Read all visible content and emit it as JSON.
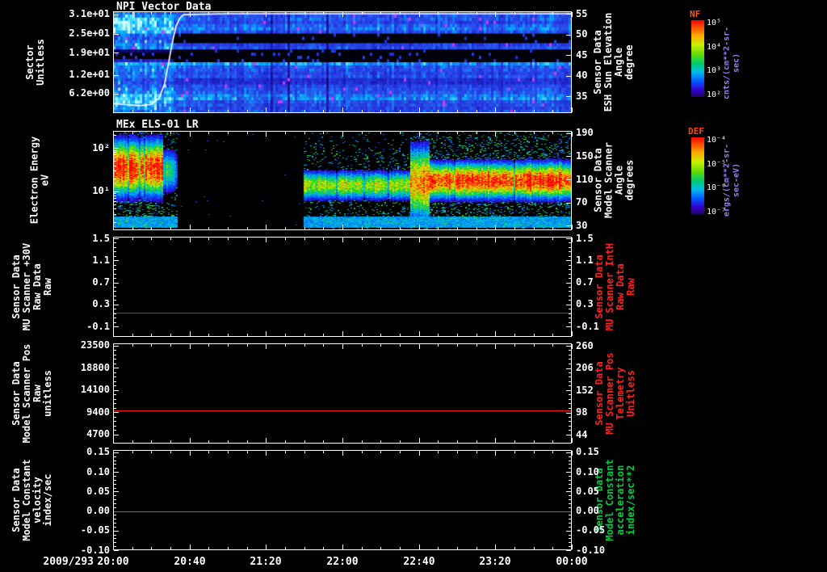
{
  "page": {
    "background": "#000000"
  },
  "panels": [
    {
      "title": "NPI Vector Data",
      "left_axis": {
        "label_lines": [
          "Sector",
          "Unitless"
        ],
        "ticks": [
          "3.1e+01",
          "2.5e+01",
          "1.9e+01",
          "1.2e+01",
          "6.2e+00"
        ],
        "tick_values": [
          31,
          25,
          19,
          12,
          6.2
        ],
        "range": [
          0,
          32
        ]
      },
      "right_axis": {
        "label_lines": [
          "Sensor Data",
          "ESH Sun Elevation",
          "Angle",
          "degree"
        ],
        "color": "#ffffff",
        "ticks": [
          "55",
          "50",
          "45",
          "40",
          "35"
        ],
        "tick_values": [
          55,
          50,
          45,
          40,
          35
        ],
        "range": [
          30.9,
          55.6
        ]
      },
      "colorbar": {
        "name": "NF",
        "name_color": "#ff5500",
        "unit": "cnts/(cm**2-sr-sec)",
        "unit_color": "#9b7bff",
        "ticks": [
          "10⁵",
          "10⁴",
          "10³",
          "10²"
        ]
      }
    },
    {
      "title": "MEx ELS-01 LR",
      "left_axis": {
        "label_lines": [
          "Electron Energy",
          "eV"
        ],
        "ticks": [
          "10²",
          "10¹"
        ],
        "tick_values": [
          2,
          1
        ],
        "range": [
          0.11,
          2.39
        ],
        "log": true
      },
      "right_axis": {
        "label_lines": [
          "Sensor Data",
          "Model Scanner",
          "Angle",
          "degrees"
        ],
        "color": "#ffffff",
        "ticks": [
          "190",
          "150",
          "110",
          "70",
          "30"
        ],
        "tick_values": [
          190,
          150,
          110,
          70,
          30
        ],
        "range": [
          21.6,
          194.2
        ]
      },
      "colorbar": {
        "name": "DEF",
        "name_color": "#ff4400",
        "unit": "ergs/(cm**2-sr-sec-eV)",
        "unit_color": "#9b7bff",
        "ticks": [
          "10⁻⁴",
          "10⁻⁵",
          "10⁻⁶",
          "10⁻⁷"
        ]
      }
    },
    {
      "title": "",
      "left_axis": {
        "label_lines": [
          "Sensor Data",
          "MU Scanner +30V",
          "Raw Data",
          "Raw"
        ],
        "ticks": [
          "1.5",
          "1.1",
          "0.7",
          "0.3",
          "-0.1"
        ],
        "tick_values": [
          1.5,
          1.1,
          0.7,
          0.3,
          -0.1
        ],
        "range": [
          -0.29,
          1.53
        ]
      },
      "right_axis": {
        "label_lines": [
          "Sensor Data",
          "MU Scanner IntH",
          "Raw Data",
          "Raw"
        ],
        "color": "#ff2020",
        "ticks": [
          "1.5",
          "1.1",
          "0.7",
          "0.3",
          "-0.1"
        ],
        "tick_values": [
          1.5,
          1.1,
          0.7,
          0.3,
          -0.1
        ],
        "range": [
          -0.29,
          1.53
        ]
      }
    },
    {
      "title": "",
      "left_axis": {
        "label_lines": [
          "Sensor Data",
          "Model Scanner Pos",
          "Raw",
          "unitless"
        ],
        "ticks": [
          "23500",
          "18800",
          "14100",
          "9400",
          "4700"
        ],
        "tick_values": [
          23500,
          18800,
          14100,
          9400,
          4700
        ],
        "range": [
          2820,
          24010
        ]
      },
      "right_axis": {
        "label_lines": [
          "Sensor Data",
          "MU Scanner Pos",
          "Telemetry",
          "Unitless"
        ],
        "color": "#ff2020",
        "ticks": [
          "260",
          "206",
          "152",
          "98",
          "44"
        ],
        "tick_values": [
          260,
          206,
          152,
          98,
          44
        ],
        "range": [
          22.4,
          265.9
        ]
      }
    },
    {
      "title": "",
      "left_axis": {
        "label_lines": [
          "Sensor Data",
          "Model Constant",
          "velocity",
          "index/sec"
        ],
        "ticks": [
          "0.15",
          "0.10",
          "0.05",
          "0.00",
          "-0.05",
          "-0.10"
        ],
        "tick_values": [
          0.15,
          0.1,
          0.05,
          0.0,
          -0.05,
          -0.1
        ],
        "range": [
          -0.1,
          0.156
        ]
      },
      "right_axis": {
        "label_lines": [
          "Sensor Data",
          "Model Constant",
          "acceleration",
          "index/sec**2"
        ],
        "color": "#00cc44",
        "ticks": [
          "0.15",
          "0.10",
          "0.05",
          "0.00",
          "-0.05",
          "-0.10"
        ],
        "tick_values": [
          0.15,
          0.1,
          0.05,
          0.0,
          -0.05,
          -0.1
        ],
        "range": [
          -0.1,
          0.156
        ]
      }
    }
  ],
  "xaxis": {
    "date": "2009/293",
    "ticks": [
      "20:00",
      "20:40",
      "21:20",
      "22:00",
      "22:40",
      "23:20",
      "00:00"
    ],
    "tick_minutes": [
      0,
      40,
      80,
      120,
      160,
      200,
      240
    ],
    "range_minutes": [
      0,
      240
    ]
  },
  "chart_data": [
    {
      "type": "heatmap",
      "panel": "NPI Vector Data",
      "x_axis": {
        "start": "2009/293 20:00",
        "end": "00:00",
        "minutes": [
          0,
          240
        ]
      },
      "y_axis": {
        "label": "Sector (Unitless)",
        "range": [
          0,
          32
        ]
      },
      "colorbar": "NF cnts/(cm**2-sr-sec)",
      "sector_row_intensity_top_to_bottom": [
        0.48,
        0.5,
        0.52,
        0.46,
        0.55,
        0.6,
        0.5,
        0.07,
        0.06,
        0.1,
        0.45,
        0.5,
        0.04,
        0.02,
        0.02,
        0.05,
        0.66,
        0.52,
        0.5,
        0.46,
        0.5,
        0.36,
        0.36,
        0.46,
        0.5,
        0.52,
        0.6,
        0.64,
        0.5,
        0.5,
        0.46,
        0.5
      ],
      "early_region": {
        "minutes": [
          0,
          31
        ],
        "row_intensity": [
          0.55,
          0.7,
          0.8,
          0.85,
          0.8,
          0.85,
          0.75,
          0.55,
          0.5,
          0.55,
          0.6,
          0.6,
          0.15,
          0.1,
          0.12,
          0.3,
          0.7,
          0.6,
          0.6,
          0.55,
          0.6,
          0.5,
          0.5,
          0.55,
          0.6,
          0.65,
          0.75,
          0.8,
          0.78,
          0.72,
          0.65,
          0.6
        ]
      },
      "speckle_color": "#c83cff",
      "overlay_line": {
        "label": "ESH Sun Elevation Angle (degree)",
        "color": "#ffffff",
        "points_min_deg": [
          [
            0,
            33.2
          ],
          [
            8,
            32.9
          ],
          [
            14,
            32.7
          ],
          [
            20,
            33.0
          ],
          [
            24,
            34.5
          ],
          [
            27,
            38
          ],
          [
            29,
            43
          ],
          [
            31,
            48
          ],
          [
            33,
            52
          ],
          [
            35,
            54
          ],
          [
            37,
            54.8
          ],
          [
            60,
            55
          ],
          [
            240,
            55
          ]
        ]
      }
    },
    {
      "type": "heatmap",
      "panel": "MEx ELS-01 LR",
      "x_axis": {
        "minutes": [
          0,
          240
        ]
      },
      "y_axis": {
        "label": "Electron Energy (eV)",
        "scale": "log",
        "range": [
          1.3,
          245
        ]
      },
      "colorbar": "DEF ergs/(cm**2-sr-sec-eV)",
      "segments": [
        {
          "minutes": [
            0,
            26
          ],
          "peak_eV": 35,
          "sigma_decades": 0.42,
          "intensity": 1.0,
          "halo": 0.55,
          "note": "intense red blob"
        },
        {
          "minutes": [
            26,
            33
          ],
          "peak_eV": 30,
          "sigma_decades": 0.35,
          "intensity": 0.45,
          "halo": 0.3,
          "note": "fading tail"
        },
        {
          "minutes": [
            33,
            99
          ],
          "peak_eV": 10,
          "sigma_decades": 0.3,
          "intensity": 0.0,
          "halo": 0.0,
          "note": "data gap (black)"
        },
        {
          "minutes": [
            99,
            155
          ],
          "peak_eV": 14,
          "sigma_decades": 0.22,
          "intensity": 0.66,
          "halo": 0.32,
          "note": "green-yellow band"
        },
        {
          "minutes": [
            155,
            165
          ],
          "peak_eV": 16,
          "sigma_decades": 0.55,
          "intensity": 0.8,
          "halo": 0.5,
          "note": "burst"
        },
        {
          "minutes": [
            165,
            240
          ],
          "peak_eV": 18,
          "sigma_decades": 0.27,
          "intensity": 0.94,
          "halo": 0.5,
          "note": "orange-red band"
        }
      ],
      "bottom_band": {
        "eV": [
          1.6,
          2.6
        ],
        "applies_minutes": [
          [
            0,
            33
          ],
          [
            99,
            240
          ]
        ],
        "intensity": 0.36
      }
    },
    {
      "type": "line",
      "panel": "MU Scanner +30V Raw Data",
      "color": "#ff1010",
      "constant_value": 0.15,
      "ylim": [
        -0.29,
        1.53
      ]
    },
    {
      "type": "line",
      "panel": "Model Scanner Pos Raw",
      "color": "#ff1010",
      "constant_value": 9800,
      "ylim": [
        2820,
        24010
      ]
    },
    {
      "type": "line",
      "panel": "Model Constant velocity",
      "color": "#00bb44",
      "constant_value": 0.0,
      "ylim": [
        -0.1,
        0.156
      ]
    }
  ]
}
